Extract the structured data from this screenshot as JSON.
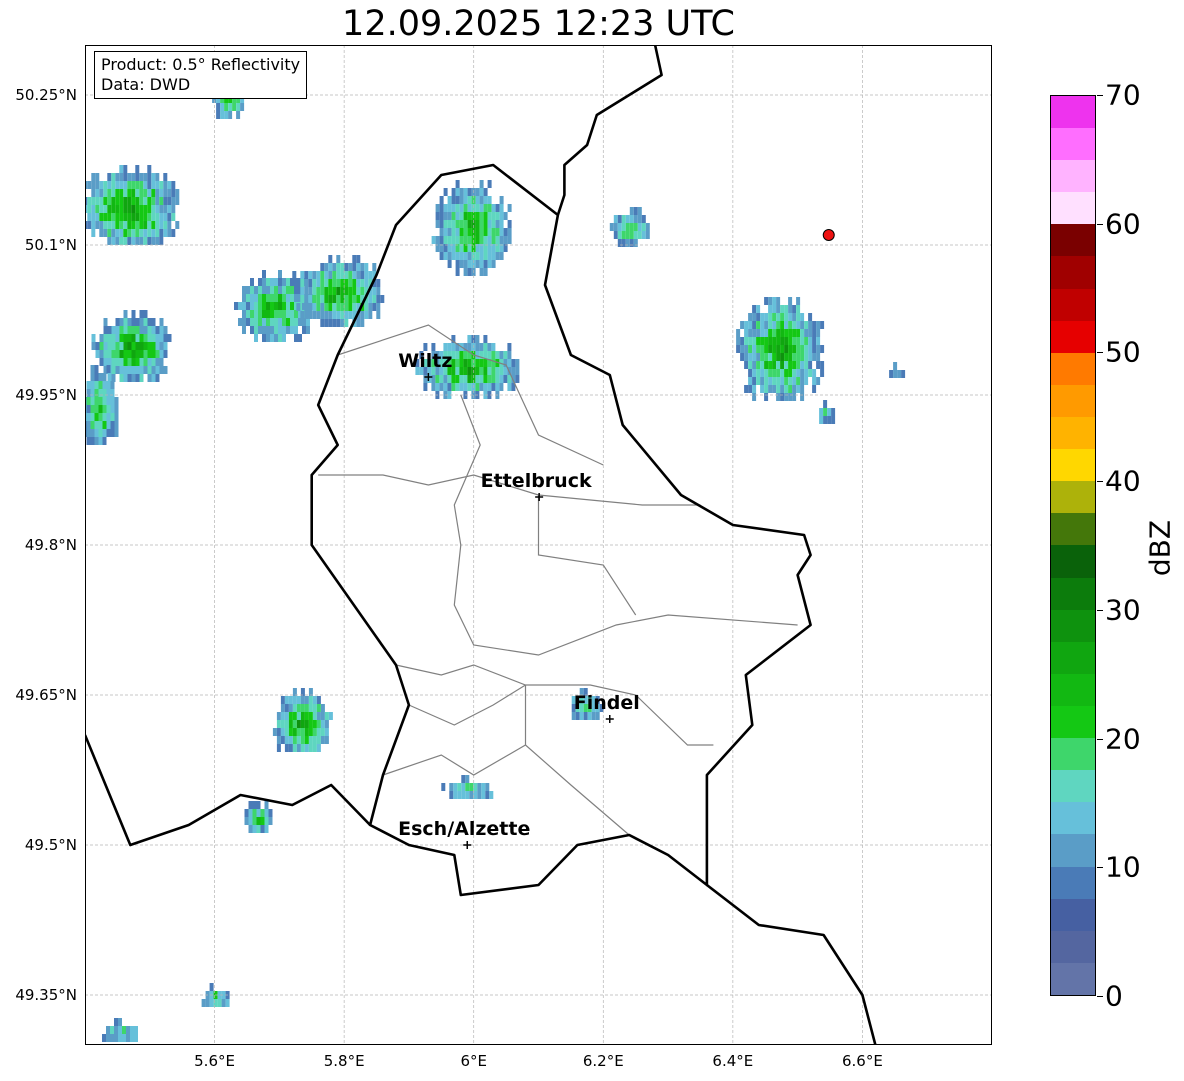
{
  "title": "12.09.2025 12:23 UTC",
  "info": {
    "product": "Product: 0.5° Reflectivity",
    "source": "Data: DWD"
  },
  "map_extent": {
    "lon_min": 5.4,
    "lon_max": 6.8,
    "lat_min": 49.3,
    "lat_max": 50.3
  },
  "lat_ticks": [
    {
      "value": 50.25,
      "label": "50.25°N"
    },
    {
      "value": 50.1,
      "label": "50.1°N"
    },
    {
      "value": 49.95,
      "label": "49.95°N"
    },
    {
      "value": 49.8,
      "label": "49.8°N"
    },
    {
      "value": 49.65,
      "label": "49.65°N"
    },
    {
      "value": 49.5,
      "label": "49.5°N"
    },
    {
      "value": 49.35,
      "label": "49.35°N"
    }
  ],
  "lon_ticks": [
    {
      "value": 5.6,
      "label": "5.6°E"
    },
    {
      "value": 5.8,
      "label": "5.8°E"
    },
    {
      "value": 6.0,
      "label": "6°E"
    },
    {
      "value": 6.2,
      "label": "6.2°E"
    },
    {
      "value": 6.4,
      "label": "6.4°E"
    },
    {
      "value": 6.6,
      "label": "6.6°E"
    }
  ],
  "cities": [
    {
      "name": "Wiltz",
      "lon": 5.93,
      "lat": 49.968
    },
    {
      "name": "Ettelbruck",
      "lon": 6.101,
      "lat": 49.848
    },
    {
      "name": "Findel",
      "lon": 6.21,
      "lat": 49.626
    },
    {
      "name": "Esch/Alzette",
      "lon": 5.99,
      "lat": 49.5
    }
  ],
  "radar_site": {
    "lon": 6.548,
    "lat": 50.11,
    "color": "#ee1111"
  },
  "colorbar": {
    "unit": "dBZ",
    "min": 0,
    "max": 70,
    "ticks": [
      0,
      10,
      20,
      30,
      40,
      50,
      60,
      70
    ],
    "colors": [
      "#6374a8",
      "#5466a0",
      "#4660a2",
      "#4a7bb7",
      "#5a9dc7",
      "#66c0da",
      "#5fd6c0",
      "#3ed66b",
      "#14c814",
      "#12b812",
      "#10a610",
      "#0e920e",
      "#0c7c0c",
      "#0a620a",
      "#44770a",
      "#adb20a",
      "#ffd700",
      "#ffb300",
      "#ff9a00",
      "#ff7a00",
      "#e60000",
      "#c00000",
      "#a00000",
      "#7a0000",
      "#ffe0ff",
      "#ffb3ff",
      "#ff6eff",
      "#ee33ee"
    ]
  },
  "echo_cells": [
    {
      "lon": 5.62,
      "lat": 50.26,
      "rlon": 0.03,
      "rlat": 0.03,
      "peak": 0.8
    },
    {
      "lon": 5.465,
      "lat": 50.14,
      "rlon": 0.08,
      "rlat": 0.04,
      "peak": 0.85
    },
    {
      "lon": 5.47,
      "lat": 50.0,
      "rlon": 0.06,
      "rlat": 0.035,
      "peak": 0.85
    },
    {
      "lon": 5.42,
      "lat": 49.94,
      "rlon": 0.03,
      "rlat": 0.04,
      "peak": 0.6
    },
    {
      "lon": 5.69,
      "lat": 50.04,
      "rlon": 0.06,
      "rlat": 0.035,
      "peak": 0.7
    },
    {
      "lon": 5.79,
      "lat": 50.055,
      "rlon": 0.07,
      "rlat": 0.035,
      "peak": 0.75
    },
    {
      "lon": 5.995,
      "lat": 50.12,
      "rlon": 0.06,
      "rlat": 0.045,
      "peak": 0.75
    },
    {
      "lon": 5.99,
      "lat": 49.98,
      "rlon": 0.08,
      "rlat": 0.03,
      "peak": 0.75
    },
    {
      "lon": 6.24,
      "lat": 50.12,
      "rlon": 0.03,
      "rlat": 0.018,
      "peak": 0.55
    },
    {
      "lon": 6.47,
      "lat": 49.998,
      "rlon": 0.065,
      "rlat": 0.05,
      "peak": 0.85
    },
    {
      "lon": 5.735,
      "lat": 49.625,
      "rlon": 0.045,
      "rlat": 0.032,
      "peak": 0.8
    },
    {
      "lon": 5.665,
      "lat": 49.53,
      "rlon": 0.025,
      "rlat": 0.014,
      "peak": 0.6
    },
    {
      "lon": 5.99,
      "lat": 49.56,
      "rlon": 0.04,
      "rlat": 0.01,
      "peak": 0.5
    },
    {
      "lon": 6.17,
      "lat": 49.643,
      "rlon": 0.025,
      "rlat": 0.014,
      "peak": 0.5
    },
    {
      "lon": 5.6,
      "lat": 49.35,
      "rlon": 0.02,
      "rlat": 0.012,
      "peak": 0.6
    },
    {
      "lon": 5.45,
      "lat": 49.315,
      "rlon": 0.03,
      "rlat": 0.012,
      "peak": 0.45
    },
    {
      "lon": 6.65,
      "lat": 49.978,
      "rlon": 0.015,
      "rlat": 0.005,
      "peak": 0.3
    },
    {
      "lon": 6.54,
      "lat": 49.935,
      "rlon": 0.013,
      "rlat": 0.01,
      "peak": 0.45
    }
  ],
  "country_border": [
    [
      6.28,
      50.3
    ],
    [
      6.29,
      50.27
    ],
    [
      6.19,
      50.23
    ],
    [
      6.175,
      50.2
    ],
    [
      6.14,
      50.18
    ],
    [
      6.14,
      50.15
    ],
    [
      6.13,
      50.13
    ],
    [
      6.11,
      50.06
    ],
    [
      6.15,
      49.99
    ],
    [
      6.21,
      49.97
    ],
    [
      6.23,
      49.92
    ],
    [
      6.32,
      49.85
    ],
    [
      6.4,
      49.82
    ],
    [
      6.51,
      49.81
    ],
    [
      6.52,
      49.79
    ],
    [
      6.5,
      49.77
    ],
    [
      6.52,
      49.72
    ],
    [
      6.42,
      49.67
    ],
    [
      6.43,
      49.62
    ],
    [
      6.36,
      49.57
    ],
    [
      6.36,
      49.46
    ],
    [
      6.3,
      49.49
    ],
    [
      6.24,
      49.51
    ],
    [
      6.16,
      49.5
    ],
    [
      6.1,
      49.46
    ],
    [
      5.98,
      49.45
    ],
    [
      5.97,
      49.49
    ],
    [
      5.9,
      49.5
    ],
    [
      5.84,
      49.52
    ],
    [
      5.86,
      49.57
    ],
    [
      5.9,
      49.64
    ],
    [
      5.88,
      49.68
    ],
    [
      5.75,
      49.8
    ],
    [
      5.75,
      49.87
    ],
    [
      5.79,
      49.9
    ],
    [
      5.76,
      49.94
    ],
    [
      5.79,
      49.99
    ],
    [
      5.85,
      50.07
    ],
    [
      5.88,
      50.12
    ],
    [
      5.95,
      50.17
    ],
    [
      6.03,
      50.18
    ],
    [
      6.13,
      50.13
    ]
  ],
  "border_west": [
    [
      5.4,
      49.61
    ],
    [
      5.47,
      49.5
    ],
    [
      5.56,
      49.52
    ],
    [
      5.64,
      49.55
    ],
    [
      5.72,
      49.54
    ],
    [
      5.78,
      49.56
    ],
    [
      5.84,
      49.52
    ]
  ],
  "border_east": [
    [
      6.36,
      49.46
    ],
    [
      6.44,
      49.42
    ],
    [
      6.54,
      49.41
    ],
    [
      6.6,
      49.35
    ],
    [
      6.62,
      49.3
    ]
  ],
  "district_lines": [
    [
      [
        5.76,
        49.87
      ],
      [
        5.86,
        49.87
      ],
      [
        5.93,
        49.86
      ],
      [
        6.0,
        49.87
      ],
      [
        6.1,
        49.85
      ],
      [
        6.26,
        49.84
      ],
      [
        6.35,
        49.84
      ]
    ],
    [
      [
        5.98,
        49.95
      ],
      [
        6.01,
        49.9
      ],
      [
        5.97,
        49.84
      ],
      [
        5.98,
        49.8
      ],
      [
        5.97,
        49.74
      ],
      [
        6.0,
        49.7
      ],
      [
        6.1,
        49.69
      ],
      [
        6.22,
        49.72
      ],
      [
        6.3,
        49.73
      ],
      [
        6.5,
        49.72
      ]
    ],
    [
      [
        5.79,
        49.99
      ],
      [
        5.93,
        50.02
      ],
      [
        6.0,
        49.99
      ],
      [
        6.05,
        49.98
      ],
      [
        6.1,
        49.91
      ],
      [
        6.2,
        49.88
      ]
    ],
    [
      [
        6.1,
        49.85
      ],
      [
        6.1,
        49.79
      ],
      [
        6.2,
        49.78
      ],
      [
        6.25,
        49.73
      ]
    ],
    [
      [
        5.88,
        49.68
      ],
      [
        5.95,
        49.67
      ],
      [
        6.0,
        49.68
      ],
      [
        6.08,
        49.66
      ],
      [
        6.18,
        49.66
      ],
      [
        6.25,
        49.65
      ],
      [
        6.33,
        49.6
      ],
      [
        6.37,
        49.6
      ]
    ],
    [
      [
        5.86,
        49.57
      ],
      [
        5.95,
        49.59
      ],
      [
        6.0,
        49.57
      ],
      [
        6.08,
        49.6
      ],
      [
        6.15,
        49.56
      ],
      [
        6.24,
        49.51
      ]
    ],
    [
      [
        6.08,
        49.66
      ],
      [
        6.08,
        49.6
      ]
    ],
    [
      [
        5.9,
        49.64
      ],
      [
        5.97,
        49.62
      ],
      [
        6.03,
        49.64
      ],
      [
        6.08,
        49.66
      ]
    ]
  ]
}
